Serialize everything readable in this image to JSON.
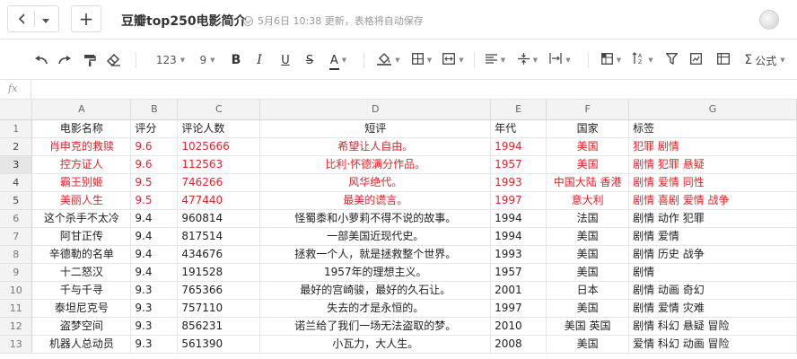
{
  "header": {
    "back_icon": "chevron-left-icon",
    "menu_caret_icon": "caret-down-icon",
    "new_icon": "plus-icon",
    "new_symbol": "+",
    "title": "豆瓣top250电影简介",
    "save_status": "5月6日 10:38 更新，表格将自动保存"
  },
  "toolbar": {
    "undo_icon": "undo-icon",
    "redo_icon": "redo-icon",
    "format_painter_icon": "paint-roller-icon",
    "clear_format_icon": "eraser-icon",
    "zoom_value": "123",
    "font_size_value": "9",
    "bold_label": "B",
    "italic_label": "I",
    "underline_label": "U",
    "strike_label": "S",
    "text_color_label": "A",
    "fill_color_icon": "paint-bucket-icon",
    "borders_icon": "borders-icon",
    "merge_icon": "merge-cells-icon",
    "align_h_icon": "align-left-icon",
    "align_v_icon": "align-middle-icon",
    "wrap_icon": "text-wrap-icon",
    "freeze_icon": "freeze-icon",
    "sort_icon": "sort-icon",
    "filter_icon": "filter-icon",
    "cond_format_icon": "conditional-format-icon",
    "formula_symbol": "Σ",
    "formula_label": "公式"
  },
  "formula_bar": {
    "fx_label": "fx"
  },
  "accent_color": "#e0242b",
  "sheet": {
    "columns": [
      "A",
      "B",
      "C",
      "D",
      "E",
      "F",
      "G"
    ],
    "rows": [
      {
        "n": "1",
        "highlight": false,
        "cells": [
          "电影名称",
          "评分",
          "评论人数",
          "短评",
          "年代",
          "国家",
          "标签"
        ]
      },
      {
        "n": "2",
        "highlight": true,
        "cells": [
          "肖申克的救赎",
          "9.6",
          "1025666",
          "希望让人自由。",
          "1994",
          "美国",
          "犯罪 剧情"
        ]
      },
      {
        "n": "3",
        "highlight": true,
        "cells": [
          "控方证人",
          "9.6",
          "112563",
          "比利·怀德满分作品。",
          "1957",
          "美国",
          "剧情 犯罪 悬疑"
        ]
      },
      {
        "n": "4",
        "highlight": true,
        "cells": [
          "霸王别姬",
          "9.5",
          "746266",
          "风华绝代。",
          "1993",
          "中国大陆 香港",
          "剧情 爱情 同性"
        ]
      },
      {
        "n": "5",
        "highlight": true,
        "cells": [
          "美丽人生",
          "9.5",
          "477440",
          "最美的谎言。",
          "1997",
          "意大利",
          "剧情 喜剧 爱情 战争"
        ]
      },
      {
        "n": "6",
        "highlight": false,
        "cells": [
          "这个杀手不太冷",
          "9.4",
          "960814",
          "怪蜀黍和小萝莉不得不说的故事。",
          "1994",
          "法国",
          "剧情 动作 犯罪"
        ]
      },
      {
        "n": "7",
        "highlight": false,
        "cells": [
          "阿甘正传",
          "9.4",
          "817514",
          "一部美国近现代史。",
          "1994",
          "美国",
          "剧情 爱情"
        ]
      },
      {
        "n": "8",
        "highlight": false,
        "cells": [
          "辛德勒的名单",
          "9.4",
          "434676",
          "拯救一个人，就是拯救整个世界。",
          "1993",
          "美国",
          "剧情 历史 战争"
        ]
      },
      {
        "n": "9",
        "highlight": false,
        "cells": [
          "十二怒汉",
          "9.4",
          "191528",
          "1957年的理想主义。",
          "1957",
          "美国",
          "剧情"
        ]
      },
      {
        "n": "10",
        "highlight": false,
        "cells": [
          "千与千寻",
          "9.3",
          "765366",
          "最好的宫崎骏，最好的久石让。",
          "2001",
          "日本",
          "剧情 动画 奇幻"
        ]
      },
      {
        "n": "11",
        "highlight": false,
        "cells": [
          "泰坦尼克号",
          "9.3",
          "757110",
          "失去的才是永恒的。",
          "1997",
          "美国",
          "剧情 爱情 灾难"
        ]
      },
      {
        "n": "12",
        "highlight": false,
        "cells": [
          "盗梦空间",
          "9.3",
          "856231",
          "诺兰给了我们一场无法盗取的梦。",
          "2010",
          "美国 英国",
          "剧情 科幻 悬疑 冒险"
        ]
      },
      {
        "n": "13",
        "highlight": false,
        "cells": [
          "机器人总动员",
          "9.3",
          "561390",
          "小瓦力，大人生。",
          "2008",
          "美国",
          "爱情 科幻 动画 冒险"
        ]
      }
    ]
  }
}
